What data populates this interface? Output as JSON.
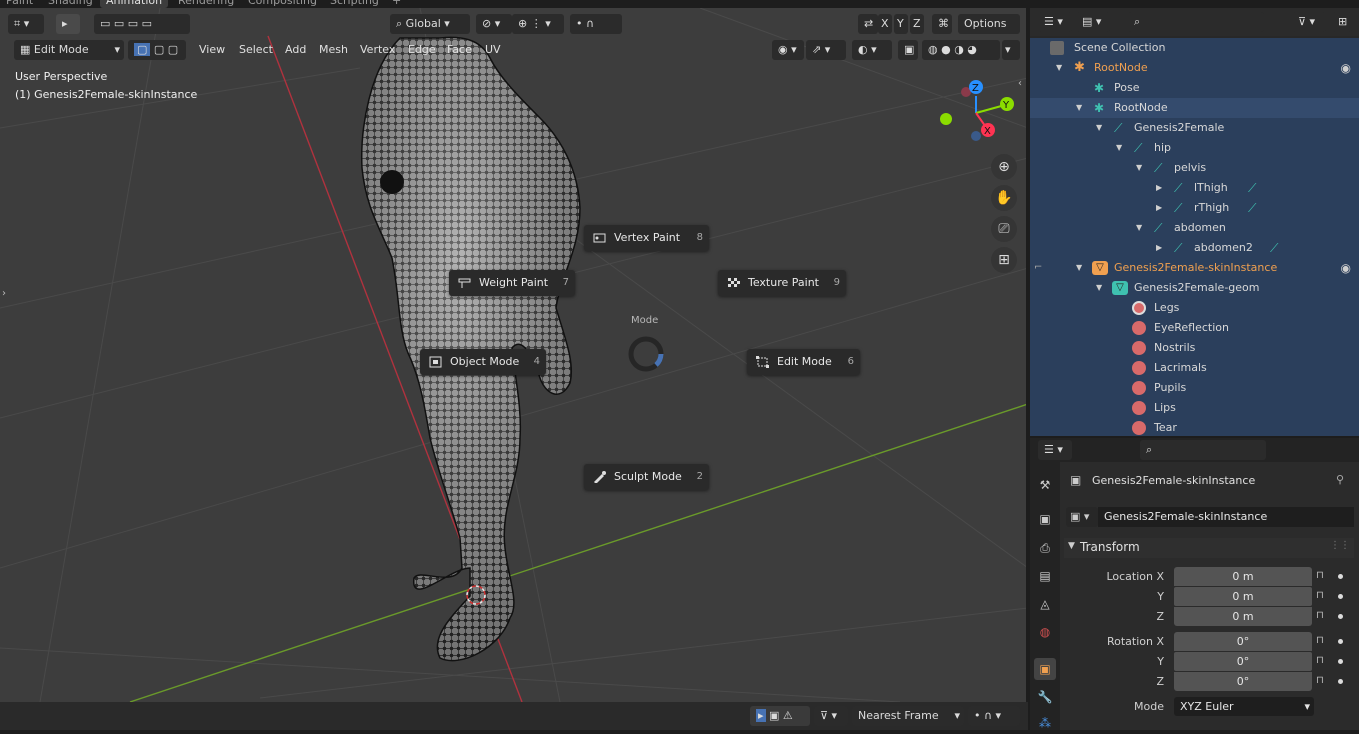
{
  "workspace_tabs": [
    "Paint",
    "Shading",
    "Animation",
    "Rendering",
    "Compositing",
    "Scripting",
    "+"
  ],
  "active_tab": "Animation",
  "viewport": {
    "mode_dropdown": "Edit Mode",
    "menus": [
      "View",
      "Select",
      "Add",
      "Mesh",
      "Vertex",
      "Edge",
      "Face",
      "UV"
    ],
    "transform_orientation": "Global",
    "axis_x": "X",
    "axis_y": "Y",
    "axis_z": "Z",
    "options_label": "Options",
    "overlay_line1": "User Perspective",
    "overlay_line2": "(1) Genesis2Female-skinInstance",
    "pie_title": "Mode",
    "pie_items": [
      {
        "label": "Vertex Paint",
        "shortcut": "8",
        "icon": "vertex-paint-icon"
      },
      {
        "label": "Weight Paint",
        "shortcut": "7",
        "icon": "weight-paint-icon"
      },
      {
        "label": "Texture Paint",
        "shortcut": "9",
        "icon": "texture-paint-icon"
      },
      {
        "label": "Object Mode",
        "shortcut": "4",
        "icon": "object-mode-icon"
      },
      {
        "label": "Edit Mode",
        "shortcut": "6",
        "icon": "edit-mode-icon"
      },
      {
        "label": "Sculpt Mode",
        "shortcut": "2",
        "icon": "sculpt-mode-icon"
      }
    ],
    "gizmo": {
      "x": "X",
      "y": "Y",
      "z": "Z"
    }
  },
  "bottombar": {
    "snap_label": "Nearest Frame"
  },
  "outliner": {
    "rows": [
      {
        "label": "Scene Collection",
        "color": "#d8d8d8"
      },
      {
        "label": "RootNode",
        "color": "#f0a050"
      },
      {
        "label": "Pose",
        "color": "#d8d8d8"
      },
      {
        "label": "RootNode",
        "color": "#d8d8d8"
      },
      {
        "label": "Genesis2Female",
        "color": "#d8d8d8"
      },
      {
        "label": "hip",
        "color": "#d8d8d8"
      },
      {
        "label": "pelvis",
        "color": "#d8d8d8"
      },
      {
        "label": "lThigh",
        "color": "#d8d8d8"
      },
      {
        "label": "rThigh",
        "color": "#d8d8d8"
      },
      {
        "label": "abdomen",
        "color": "#d8d8d8"
      },
      {
        "label": "abdomen2",
        "color": "#d8d8d8"
      },
      {
        "label": "Genesis2Female-skinInstance",
        "color": "#f0a050"
      },
      {
        "label": "Genesis2Female-geom",
        "color": "#d8d8d8"
      },
      {
        "label": "Legs",
        "color": "#d8d8d8"
      },
      {
        "label": "EyeReflection",
        "color": "#d8d8d8"
      },
      {
        "label": "Nostrils",
        "color": "#d8d8d8"
      },
      {
        "label": "Lacrimals",
        "color": "#d8d8d8"
      },
      {
        "label": "Pupils",
        "color": "#d8d8d8"
      },
      {
        "label": "Lips",
        "color": "#d8d8d8"
      },
      {
        "label": "Tear",
        "color": "#d8d8d8"
      }
    ]
  },
  "properties": {
    "object_title": "Genesis2Female-skinInstance",
    "object_name": "Genesis2Female-skinInstance",
    "panel_title": "Transform",
    "location_label": "Location X",
    "rotation_label": "Rotation X",
    "y_label": "Y",
    "z_label": "Z",
    "location": [
      "0 m",
      "0 m",
      "0 m"
    ],
    "rotation": [
      "0°",
      "0°",
      "0°"
    ],
    "mode_label": "Mode",
    "mode_value": "XYZ Euler"
  },
  "colors": {
    "accent": "#4772b3",
    "orange": "#f0a050",
    "bone": "#3fc1b0",
    "x_axis": "#ff3352",
    "y_axis": "#8bdc00",
    "z_axis": "#2890ff"
  }
}
